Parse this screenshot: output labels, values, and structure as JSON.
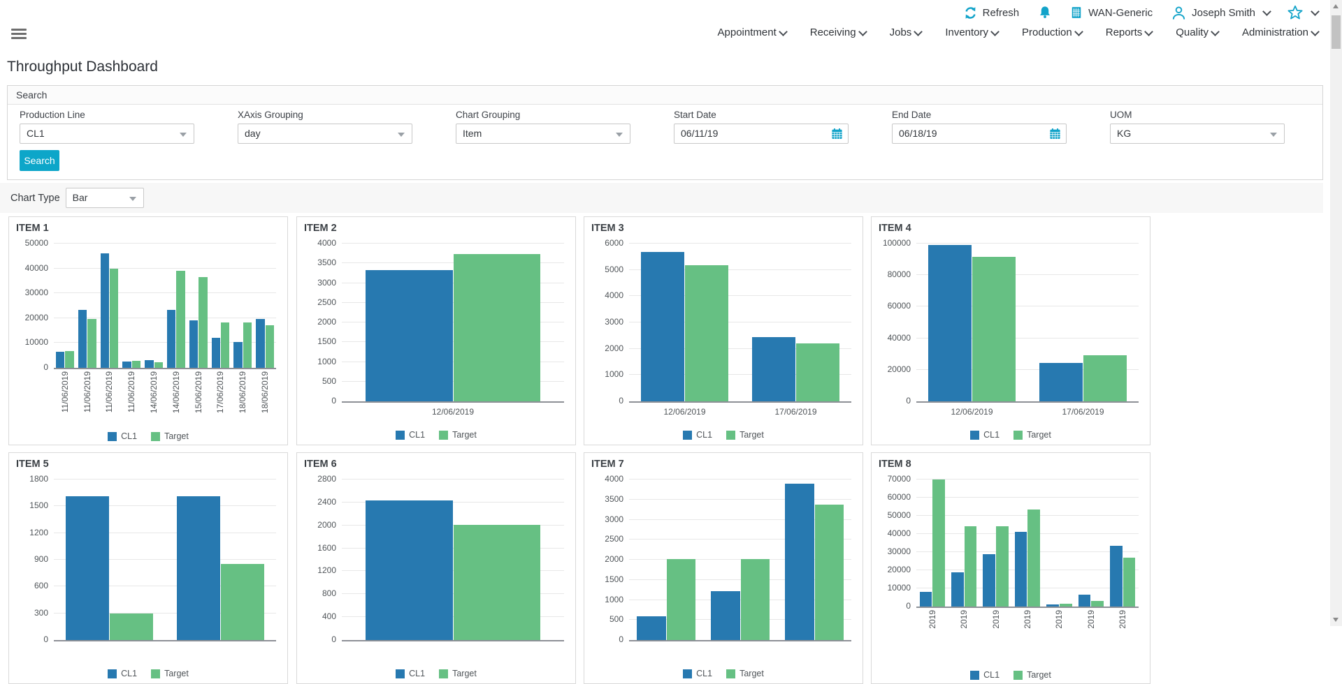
{
  "header": {
    "refresh_label": "Refresh",
    "tenant": "WAN-Generic",
    "user": "Joseph Smith"
  },
  "nav": {
    "items": [
      {
        "label": "Appointment"
      },
      {
        "label": "Receiving"
      },
      {
        "label": "Jobs"
      },
      {
        "label": "Inventory"
      },
      {
        "label": "Production"
      },
      {
        "label": "Reports"
      },
      {
        "label": "Quality"
      },
      {
        "label": "Administration"
      }
    ]
  },
  "page": {
    "title": "Throughput Dashboard"
  },
  "search_panel": {
    "title": "Search",
    "fields": [
      {
        "label": "Production Line",
        "value": "CL1",
        "type": "select"
      },
      {
        "label": "XAxis Grouping",
        "value": "day",
        "type": "select"
      },
      {
        "label": "Chart Grouping",
        "value": "Item",
        "type": "select"
      },
      {
        "label": "Start Date",
        "value": "06/11/19",
        "type": "date"
      },
      {
        "label": "End Date",
        "value": "06/18/19",
        "type": "date"
      },
      {
        "label": "UOM",
        "value": "KG",
        "type": "select"
      }
    ],
    "search_button": "Search"
  },
  "chart_controls": {
    "label": "Chart Type",
    "value": "Bar"
  },
  "colors": {
    "accent": "#12a3c9",
    "bar_blue": "#2779b0",
    "bar_green": "#66c083",
    "gridline": "#e7e7e7"
  },
  "chart_data": [
    {
      "type": "bar",
      "title": "ITEM 1",
      "categories": [
        "11/06/2019",
        "11/06/2019",
        "11/06/2019",
        "11/06/2019",
        "14/06/2019",
        "14/06/2019",
        "15/06/2019",
        "17/06/2019",
        "18/06/2019",
        "18/06/2019"
      ],
      "series": [
        {
          "name": "CL1",
          "color": "#2779b0",
          "values": [
            6500,
            23200,
            46200,
            2600,
            3200,
            23400,
            19000,
            12200,
            10300,
            19700
          ]
        },
        {
          "name": "Target",
          "color": "#66c083",
          "values": [
            6800,
            19800,
            39800,
            2900,
            2250,
            39100,
            36600,
            18300,
            18300,
            17000
          ]
        }
      ],
      "ymax": 50000,
      "ystep": 10000,
      "ylim": [
        0,
        50000
      ],
      "xlabels_rotated": true,
      "legend_position": "bottom",
      "grid": true
    },
    {
      "type": "bar",
      "title": "ITEM 2",
      "categories": [
        "12/06/2019"
      ],
      "series": [
        {
          "name": "CL1",
          "color": "#2779b0",
          "values": [
            3330
          ]
        },
        {
          "name": "Target",
          "color": "#66c083",
          "values": [
            3730
          ]
        }
      ],
      "ymax": 4000,
      "ystep": 500,
      "ylim": [
        0,
        4000
      ],
      "xlabels_rotated": false,
      "legend_position": "bottom",
      "grid": true
    },
    {
      "type": "bar",
      "title": "ITEM 3",
      "categories": [
        "12/06/2019",
        "17/06/2019"
      ],
      "series": [
        {
          "name": "CL1",
          "color": "#2779b0",
          "values": [
            5670,
            2430
          ]
        },
        {
          "name": "Target",
          "color": "#66c083",
          "values": [
            5190,
            2200
          ]
        }
      ],
      "ymax": 6000,
      "ystep": 1000,
      "ylim": [
        0,
        6000
      ],
      "xlabels_rotated": false,
      "legend_position": "bottom",
      "grid": true
    },
    {
      "type": "bar",
      "title": "ITEM 4",
      "categories": [
        "12/06/2019",
        "17/06/2019"
      ],
      "series": [
        {
          "name": "CL1",
          "color": "#2779b0",
          "values": [
            99000,
            24500
          ]
        },
        {
          "name": "Target",
          "color": "#66c083",
          "values": [
            91500,
            29000
          ]
        }
      ],
      "ymax": 100000,
      "ystep": 20000,
      "ylim": [
        0,
        100000
      ],
      "xlabels_rotated": false,
      "legend_position": "bottom",
      "grid": true
    },
    {
      "type": "bar",
      "title": "ITEM 5",
      "categories": [
        "",
        ""
      ],
      "series": [
        {
          "name": "CL1",
          "color": "#2779b0",
          "values": [
            1610,
            1610
          ]
        },
        {
          "name": "Target",
          "color": "#66c083",
          "values": [
            300,
            850
          ]
        }
      ],
      "ymax": 1800,
      "ystep": 300,
      "ylim": [
        0,
        1800
      ],
      "xlabels_rotated": false,
      "legend_position": "bottom",
      "grid": true
    },
    {
      "type": "bar",
      "title": "ITEM 6",
      "categories": [
        ""
      ],
      "series": [
        {
          "name": "CL1",
          "color": "#2779b0",
          "values": [
            2430
          ]
        },
        {
          "name": "Target",
          "color": "#66c083",
          "values": [
            2010
          ]
        }
      ],
      "ymax": 2800,
      "ystep": 400,
      "ylim": [
        0,
        2800
      ],
      "xlabels_rotated": false,
      "legend_position": "bottom",
      "grid": true
    },
    {
      "type": "bar",
      "title": "ITEM 7",
      "categories": [
        "",
        "",
        ""
      ],
      "series": [
        {
          "name": "CL1",
          "color": "#2779b0",
          "values": [
            600,
            1220,
            3890
          ]
        },
        {
          "name": "Target",
          "color": "#66c083",
          "values": [
            2020,
            2020,
            3380
          ]
        }
      ],
      "ymax": 4000,
      "ystep": 500,
      "ylim": [
        0,
        4000
      ],
      "xlabels_rotated": false,
      "legend_position": "bottom",
      "grid": true
    },
    {
      "type": "bar",
      "title": "ITEM 8",
      "categories": [
        "2019",
        "2019",
        "2019",
        "2019",
        "2019",
        "2019",
        "2019"
      ],
      "series": [
        {
          "name": "CL1",
          "color": "#2779b0",
          "values": [
            8000,
            19000,
            29000,
            41200,
            1200,
            6500,
            33300
          ]
        },
        {
          "name": "Target",
          "color": "#66c083",
          "values": [
            70000,
            44300,
            44300,
            53400,
            1700,
            3000,
            27000
          ]
        }
      ],
      "ymax": 70000,
      "ystep": 10000,
      "ylim": [
        0,
        70000
      ],
      "xlabels_rotated": true,
      "legend_position": "bottom",
      "grid": true
    }
  ]
}
